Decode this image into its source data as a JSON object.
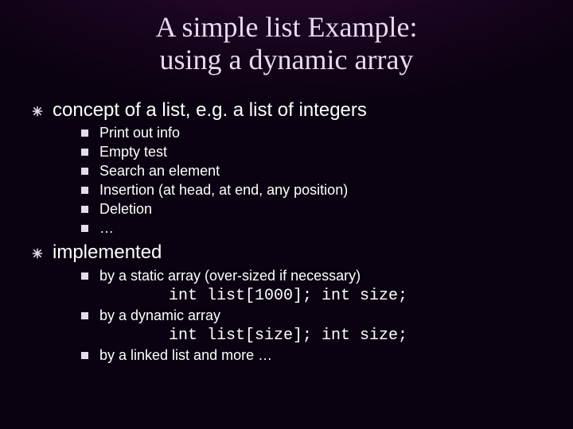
{
  "title_line1": "A simple list Example:",
  "title_line2": "using a dynamic array",
  "section1": {
    "heading": "concept of a list, e.g. a list of integers",
    "items": [
      "Print out info",
      "Empty test",
      "Search an element",
      "Insertion (at head, at end, any position)",
      "Deletion",
      "…"
    ]
  },
  "section2": {
    "heading": "implemented",
    "items": [
      {
        "text": "by a static array (over-sized if necessary)",
        "code": "int list[1000]; int size;"
      },
      {
        "text": "by a dynamic array",
        "code": "int list[size]; int size;"
      },
      {
        "text": "by a linked list and more …",
        "code": null
      }
    ]
  }
}
